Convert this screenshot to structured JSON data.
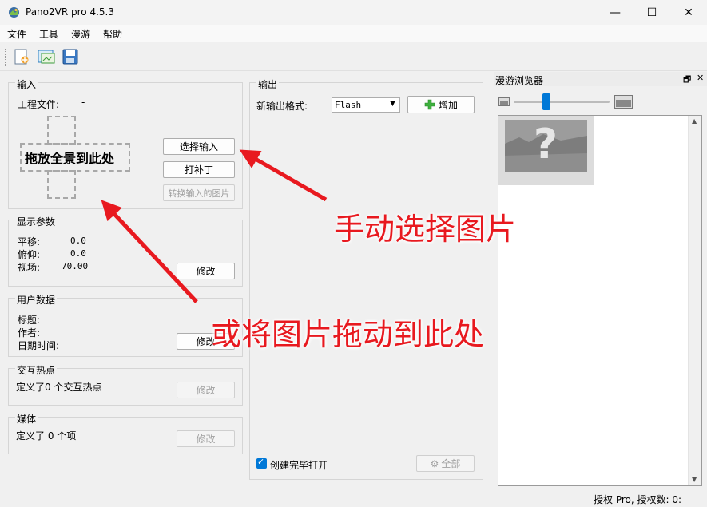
{
  "window": {
    "title": "Pano2VR pro 4.5.3",
    "controls": {
      "minimize": "—",
      "maximize": "☐",
      "close": "✕"
    }
  },
  "menu": [
    "文件",
    "工具",
    "漫游",
    "帮助"
  ],
  "toolbar": {
    "icons": [
      "new-project-icon",
      "open-project-icon",
      "save-icon"
    ]
  },
  "input": {
    "title": "输入",
    "project_file_label": "工程文件:",
    "project_file_value": "-",
    "drop_text": "拖放全景到此处",
    "select_input": "选择输入",
    "patch": "打补丁",
    "convert_input": "转换输入的图片"
  },
  "display": {
    "title": "显示参数",
    "pan_label": "平移:",
    "pan_value": "0.0",
    "tilt_label": "俯仰:",
    "tilt_value": "0.0",
    "fov_label": "视场:",
    "fov_value": "70.00",
    "modify": "修改"
  },
  "userdata": {
    "title": "用户数据",
    "title_label": "标题:",
    "author_label": "作者:",
    "datetime_label": "日期时间:",
    "modify": "修改"
  },
  "hotspots": {
    "title": "交互热点",
    "text": "定义了0 个交互热点",
    "modify": "修改"
  },
  "media": {
    "title": "媒体",
    "text": "定义了 0 个项",
    "modify": "修改"
  },
  "output": {
    "title": "输出",
    "new_format_label": "新输出格式:",
    "format_value": "Flash",
    "add": "增加",
    "open_after": "创建完毕打开",
    "open_after_checked": true,
    "all": "全部"
  },
  "browser": {
    "title": "漫游浏览器",
    "float": "🗗",
    "close": "✕"
  },
  "status": {
    "text": "授权 Pro, 授权数: 0:"
  },
  "annotations": {
    "manual": "手动选择图片",
    "drag": "或将图片拖动到此处"
  },
  "colors": {
    "annotation": "#e8191f",
    "accent": "#0078d7"
  }
}
